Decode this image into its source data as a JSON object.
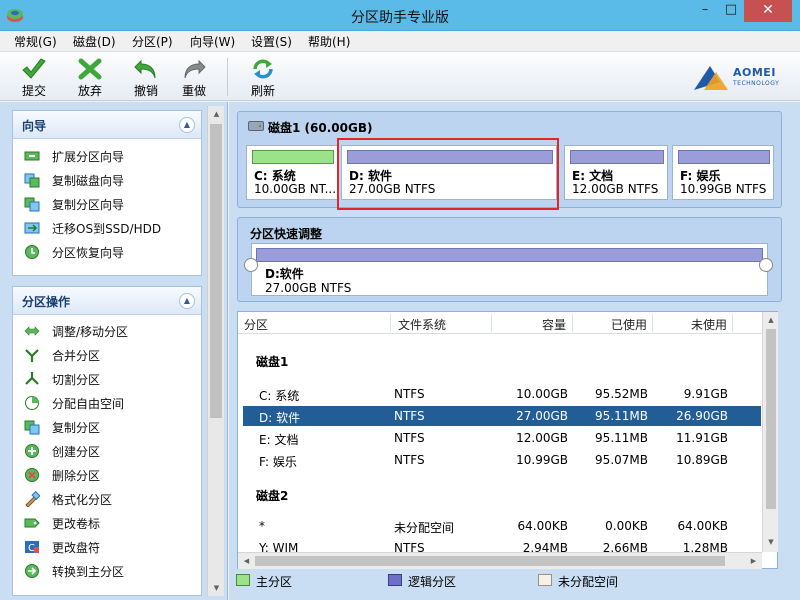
{
  "window": {
    "title": "分区助手专业版",
    "controls": {
      "minimize": "–",
      "maximize": "□",
      "close": "✕"
    }
  },
  "menu": [
    "常规(G)",
    "磁盘(D)",
    "分区(P)",
    "向导(W)",
    "设置(S)",
    "帮助(H)"
  ],
  "toolbar": {
    "commit": "提交",
    "discard": "放弃",
    "undo": "撤销",
    "redo": "重做",
    "refresh": "刷新",
    "brand": "AOMEI",
    "brand_sub": "TECHNOLOGY"
  },
  "wizard_panel": {
    "title": "向导",
    "items": [
      "扩展分区向导",
      "复制磁盘向导",
      "复制分区向导",
      "迁移OS到SSD/HDD",
      "分区恢复向导"
    ]
  },
  "partition_ops_panel": {
    "title": "分区操作",
    "items": [
      "调整/移动分区",
      "合并分区",
      "切割分区",
      "分配自由空间",
      "复制分区",
      "创建分区",
      "删除分区",
      "格式化分区",
      "更改卷标",
      "更改盘符",
      "转换到主分区"
    ]
  },
  "disk_map": {
    "title": "磁盘1 (60.00GB)",
    "partitions": [
      {
        "name": "C: 系统",
        "size": "10.00GB NT...",
        "bar_color": "#9ce28a"
      },
      {
        "name": "D: 软件",
        "size": "27.00GB NTFS",
        "bar_color": "#9b9ddb"
      },
      {
        "name": "E: 文档",
        "size": "12.00GB NTFS",
        "bar_color": "#9b9ddb"
      },
      {
        "name": "F: 娱乐",
        "size": "10.99GB NTFS",
        "bar_color": "#9b9ddb"
      }
    ]
  },
  "quick_adjust": {
    "title": "分区快速调整",
    "name": "D:软件",
    "size": "27.00GB NTFS"
  },
  "table": {
    "columns": [
      "分区",
      "文件系统",
      "容量",
      "已使用",
      "未使用"
    ],
    "groups": [
      {
        "name": "磁盘1",
        "rows": [
          {
            "partition": "C: 系统",
            "fs": "NTFS",
            "capacity": "10.00GB",
            "used": "95.52MB",
            "free": "9.91GB",
            "selected": false
          },
          {
            "partition": "D: 软件",
            "fs": "NTFS",
            "capacity": "27.00GB",
            "used": "95.11MB",
            "free": "26.90GB",
            "selected": true
          },
          {
            "partition": "E: 文档",
            "fs": "NTFS",
            "capacity": "12.00GB",
            "used": "95.11MB",
            "free": "11.91GB",
            "selected": false
          },
          {
            "partition": "F: 娱乐",
            "fs": "NTFS",
            "capacity": "10.99GB",
            "used": "95.07MB",
            "free": "10.89GB",
            "selected": false
          }
        ]
      },
      {
        "name": "磁盘2",
        "rows": [
          {
            "partition": "*",
            "fs": "未分配空间",
            "capacity": "64.00KB",
            "used": "0.00KB",
            "free": "64.00KB",
            "selected": false
          },
          {
            "partition": "Y: WIM",
            "fs": "NTFS",
            "capacity": "2.94MB",
            "used": "2.66MB",
            "free": "1.28MB",
            "selected": false
          }
        ]
      }
    ]
  },
  "legend": [
    {
      "label": "主分区",
      "color": "#9ce28a"
    },
    {
      "label": "逻辑分区",
      "color": "#6c70c8"
    },
    {
      "label": "未分配空间",
      "color": "#f5f0ea"
    }
  ],
  "colors": {
    "titlebar": "#5bbbe8",
    "selection": "#235d96",
    "highlight_border": "#e22525",
    "pane_bg": "#c9ddf3"
  }
}
